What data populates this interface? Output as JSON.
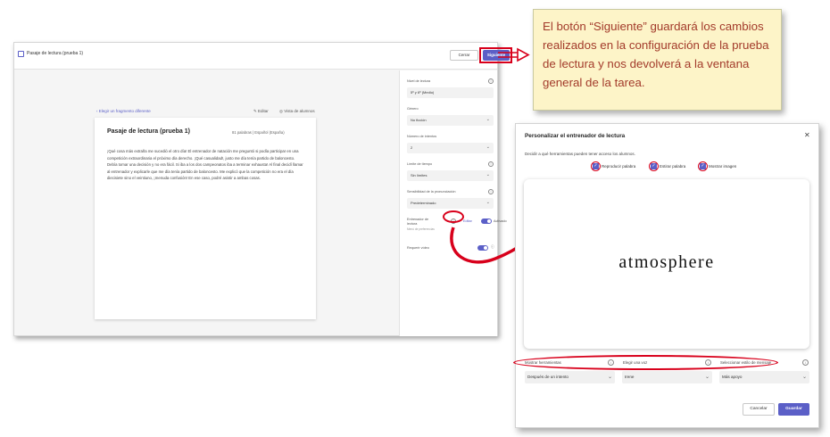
{
  "main": {
    "title": "Pasaje de lectura (prueba 1)",
    "close_label": "Cerrar",
    "next_label": "Siguiente",
    "choose_fragment": "Elegir un fragmento diferente",
    "edit_label": "Editar",
    "student_view": "Vista de alumnos",
    "card": {
      "title": "Pasaje de lectura (prueba 1)",
      "meta": "81 palabras  |  Español (España)",
      "body": "¡Qué cosa más extraña me sucedió el otro día! El entrenador de natación me preguntó si podía participar en una competición extraordinaria el próximo día derecho. ¡Qué casualidad!, justo me día tenía partido de baloncesto. Debía tomar una decisión y no era fácil. Si iba a los dos campeonatos iba a terminar exhausta! Al final decidí llamar al entrenador y explicarle que me día tenía partido de baloncesto. Me explicó que la competición no era el día diecisiete sino el veintiuno, ¡menuda confusión! En ese caso, podré asistir a ambas cosas."
    },
    "panel": {
      "level_label": "Nivel de lectura",
      "level_value": "5º y 6º (Medio)",
      "genre_label": "Género",
      "genre_value": "No ficción",
      "attempts_label": "Número de intentos",
      "attempts_value": "2",
      "time_label": "Límite de tiempo",
      "time_value": "Sin límites",
      "pron_label": "Sensibilidad de la pronunciación",
      "pron_value": "Predeterminado",
      "coach_label": "Entrenador de lectura",
      "coach_sub": "Menú de preferencias",
      "coach_edit": "Editar",
      "coach_state": "Activado",
      "video_label": "Requerir vídeo"
    }
  },
  "callout": {
    "text": "El botón “Siguiente” guardará los cambios realizados en la configuración de la prueba de lectura y nos devolverá a la ventana general de la tarea."
  },
  "dialog": {
    "title": "Personalizar el entrenador de lectura",
    "description": "Decidir a qué herramientas pueden tener acceso los alumnos.",
    "options": [
      {
        "label": "Reproducir palabra"
      },
      {
        "label": "Estirar palabra"
      },
      {
        "label": "Mostrar imagen"
      }
    ],
    "preview_word": "atmosphere",
    "fields": [
      {
        "label": "Mostrar herramientas",
        "value": "Después de un intento"
      },
      {
        "label": "Elegir una voz",
        "value": "Irene"
      },
      {
        "label": "Seleccionar estilo de mensaje",
        "value": "Más apoyo"
      }
    ],
    "cancel_label": "Cancelar",
    "save_label": "Guardar"
  },
  "colors": {
    "accent": "#5b5fc7",
    "highlight": "#d8001b",
    "callout_bg": "#fdf4c8",
    "callout_text": "#a33b2b"
  }
}
